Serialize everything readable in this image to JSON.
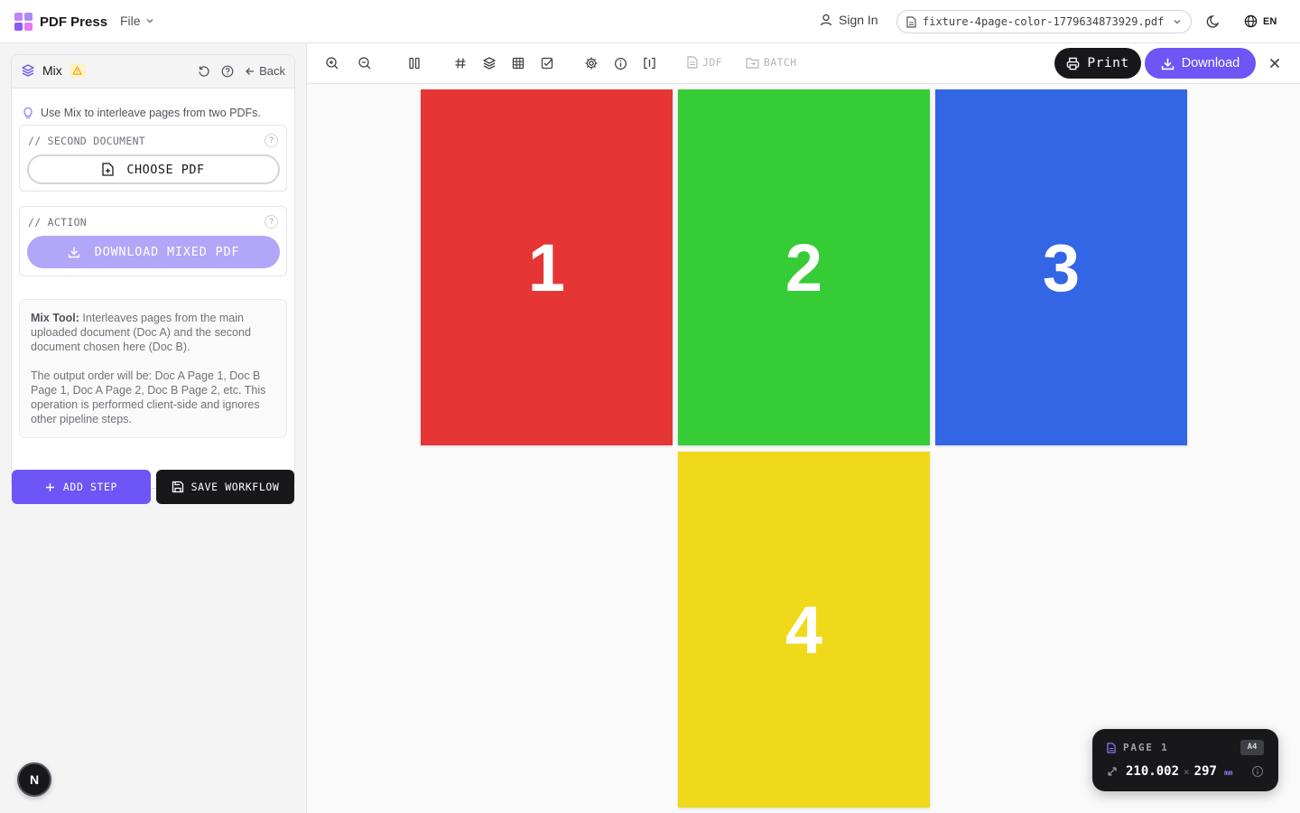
{
  "app": {
    "name": "PDF Press",
    "file_menu": "File",
    "sign_in": "Sign In",
    "current_file": "fixture-4page-color-1779634873929.pdf",
    "language": "EN"
  },
  "colors": {
    "accent": "#6d55f6",
    "accent_disabled": "#b1a6f8",
    "dark": "#18181b",
    "warning": "#f59e0b"
  },
  "sidebar": {
    "tool_title": "Mix",
    "back_label": "Back",
    "hint": "Use Mix to interleave pages from two PDFs.",
    "second_document": {
      "label": "// SECOND DOCUMENT",
      "help": "?",
      "button": "CHOOSE PDF"
    },
    "action": {
      "label": "// ACTION",
      "help": "?",
      "button": "DOWNLOAD MIXED PDF"
    },
    "info": {
      "lead": "Mix Tool:",
      "text1": "Interleaves pages from the main uploaded document (Doc A) and the second document chosen here (Doc B).",
      "text2": "The output order will be: Doc A Page 1, Doc B Page 1, Doc A Page 2, Doc B Page 2, etc. This operation is performed client-side and ignores other pipeline steps."
    },
    "add_step": "ADD STEP",
    "save_workflow": "SAVE WORKFLOW",
    "badge": "N"
  },
  "toolbar": {
    "icons": [
      "zoom-in-icon",
      "zoom-out-icon",
      "columns-icon",
      "hash-icon",
      "layers-icon",
      "grid-icon",
      "checkbox-icon",
      "settings-icon",
      "info-icon",
      "brackets-icon"
    ],
    "jdf_label": "JDF",
    "batch_label": "BATCH",
    "print_label": "Print",
    "download_label": "Download"
  },
  "pages": [
    {
      "number": "1",
      "color": "#e53535"
    },
    {
      "number": "2",
      "color": "#35cc35"
    },
    {
      "number": "3",
      "color": "#3366e5"
    },
    {
      "number": "4",
      "color": "#f0d91a"
    }
  ],
  "page_info": {
    "label": "PAGE 1",
    "size": "A4",
    "width": "210.002",
    "times": "×",
    "height": "297",
    "unit": "mm"
  }
}
